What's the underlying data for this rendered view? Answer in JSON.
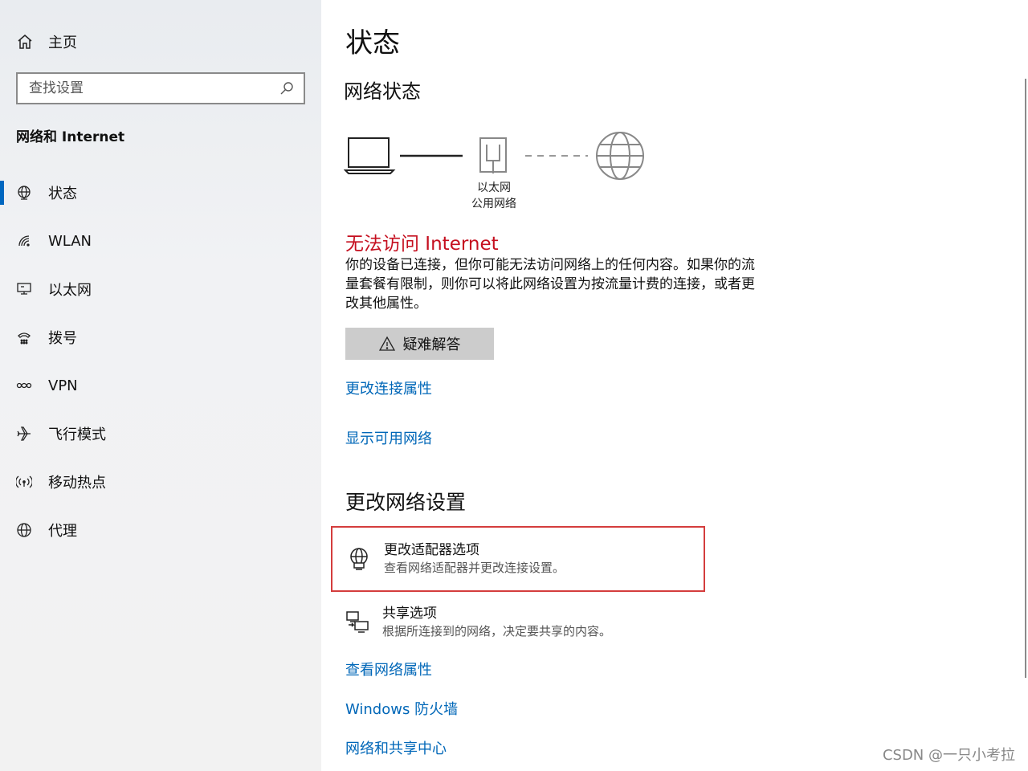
{
  "sidebar": {
    "home_label": "主页",
    "search_placeholder": "查找设置",
    "section_title": "网络和 Internet",
    "items": [
      {
        "label": "状态",
        "icon": "globe-status-icon",
        "active": true
      },
      {
        "label": "WLAN",
        "icon": "wifi-icon"
      },
      {
        "label": "以太网",
        "icon": "ethernet-icon"
      },
      {
        "label": "拨号",
        "icon": "dialup-icon"
      },
      {
        "label": "VPN",
        "icon": "vpn-icon"
      },
      {
        "label": "飞行模式",
        "icon": "airplane-icon"
      },
      {
        "label": "移动热点",
        "icon": "hotspot-icon"
      },
      {
        "label": "代理",
        "icon": "globe-icon"
      }
    ]
  },
  "main": {
    "title": "状态",
    "network_status_title": "网络状态",
    "diagram": {
      "adapter_name": "以太网",
      "network_type": "公用网络"
    },
    "status_error": "无法访问 Internet",
    "status_description": "你的设备已连接，但你可能无法访问网络上的任何内容。如果你的流量套餐有限制，则你可以将此网络设置为按流量计费的连接，或者更改其他属性。",
    "troubleshoot_label": "疑难解答",
    "link_change_connection": "更改连接属性",
    "link_show_networks": "显示可用网络",
    "change_settings_title": "更改网络设置",
    "options": [
      {
        "title": "更改适配器选项",
        "desc": "查看网络适配器并更改连接设置。",
        "icon": "adapter-icon"
      },
      {
        "title": "共享选项",
        "desc": "根据所连接到的网络，决定要共享的内容。",
        "icon": "sharing-icon"
      }
    ],
    "link_view_properties": "查看网络属性",
    "link_firewall": "Windows 防火墙",
    "link_sharing_center": "网络和共享中心"
  },
  "colors": {
    "accent": "#0067b8",
    "error": "#c50f1f",
    "highlight_box": "#d43d3d"
  },
  "watermark": "CSDN @一只小考拉"
}
